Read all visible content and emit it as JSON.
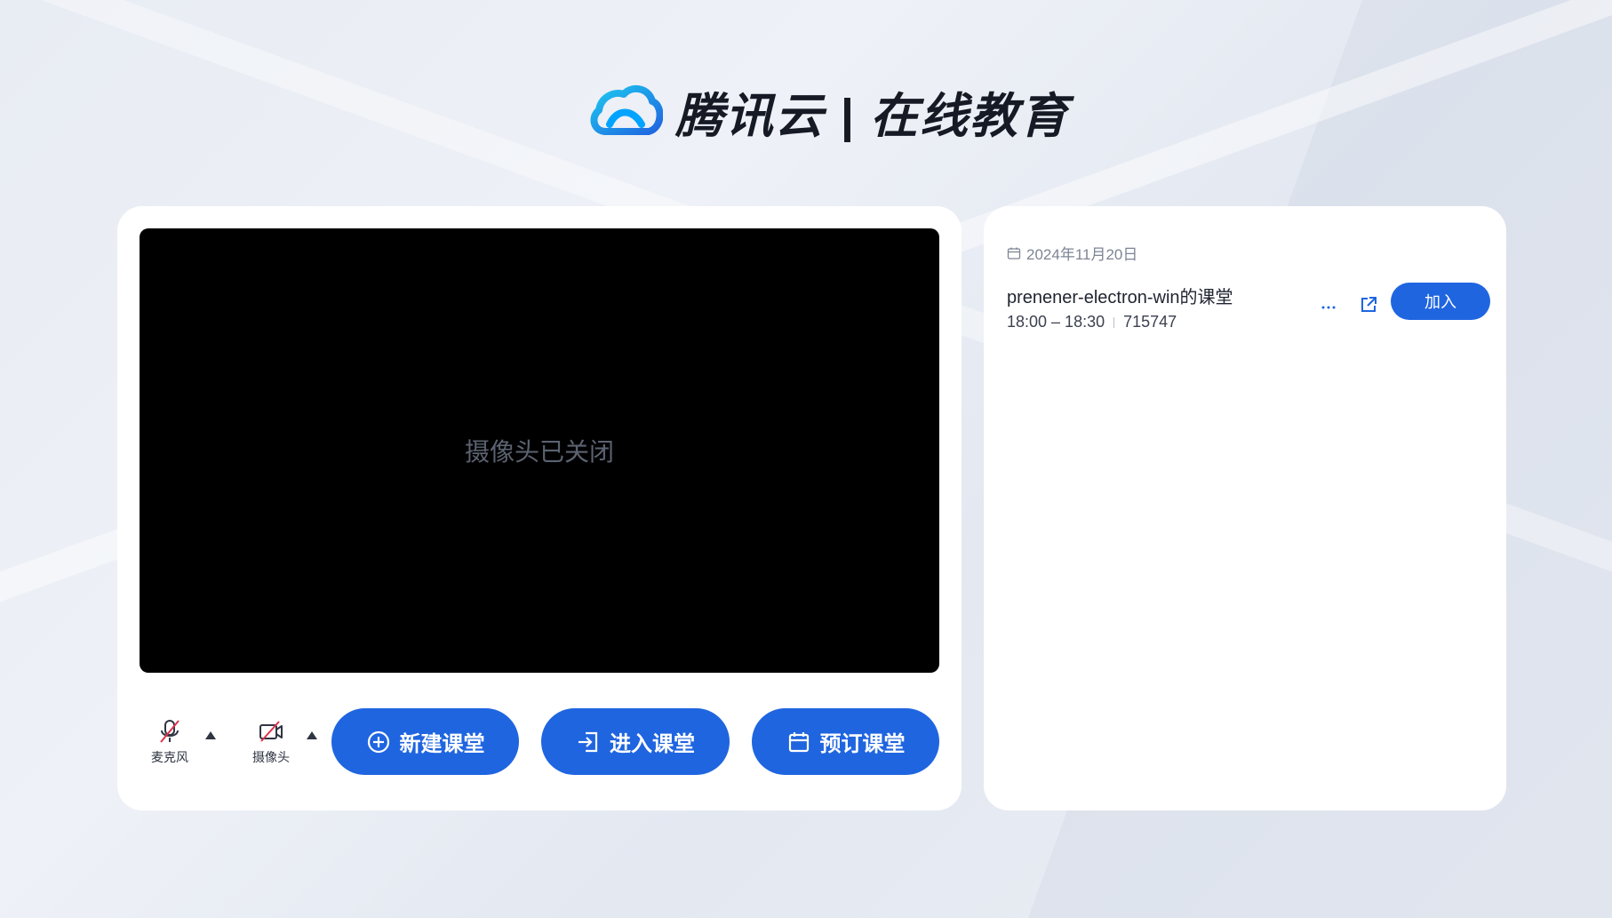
{
  "app": {
    "logo_text": "腾讯云 | 在线教育",
    "brand_color": "#1f65e0"
  },
  "preview": {
    "camera_off_text": "摄像头已关闭"
  },
  "devices": {
    "mic_label": "麦克风",
    "camera_label": "摄像头"
  },
  "actions": {
    "new_class": "新建课堂",
    "enter_class": "进入课堂",
    "book_class": "预订课堂"
  },
  "schedule": {
    "date": "2024年11月20日",
    "items": [
      {
        "name": "prenener-electron-win的课堂",
        "time": "18:00 – 18:30",
        "room_id": "715747",
        "join_label": "加入"
      }
    ]
  },
  "icons": {
    "logo": "cloud-logo-icon",
    "mic": "mic-off-icon",
    "camera": "camera-off-icon",
    "new": "plus-circle-icon",
    "enter": "enter-icon",
    "book": "calendar-icon",
    "more": "more-icon",
    "share": "external-link-icon"
  }
}
